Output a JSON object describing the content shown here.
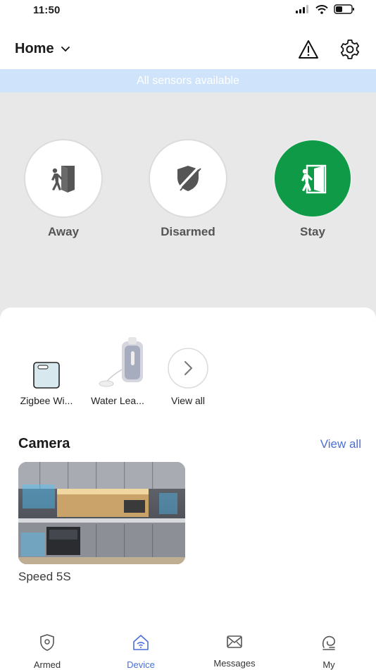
{
  "status_bar": {
    "time": "11:50"
  },
  "header": {
    "title": "Home"
  },
  "banner": {
    "text": "All sensors available"
  },
  "modes": [
    {
      "label": "Away",
      "active": false
    },
    {
      "label": "Disarmed",
      "active": false
    },
    {
      "label": "Stay",
      "active": true
    }
  ],
  "devices": [
    {
      "label": "Zigbee Wi..."
    },
    {
      "label": "Water Lea..."
    },
    {
      "label": "View all"
    }
  ],
  "camera": {
    "title": "Camera",
    "view_all": "View all",
    "name": "Speed 5S"
  },
  "tabs": [
    {
      "label": "Armed",
      "active": false
    },
    {
      "label": "Device",
      "active": true
    },
    {
      "label": "Messages",
      "active": false
    },
    {
      "label": "My",
      "active": false
    }
  ],
  "colors": {
    "accent": "#4a6fd8",
    "stay_active": "#0f9a48",
    "banner_bg": "#cfe4fb",
    "panel_bg": "#e8e8e8"
  }
}
